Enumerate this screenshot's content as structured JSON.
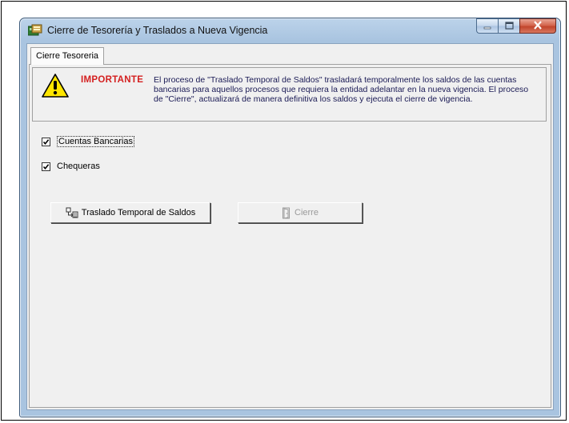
{
  "window": {
    "title": "Cierre de Tesorería  y Traslados a Nueva Vigencia"
  },
  "tabs": [
    {
      "label": "Cierre Tesoreria"
    }
  ],
  "notice": {
    "label": "IMPORTANTE",
    "text": "El proceso de \"Traslado Temporal de Saldos\" trasladará temporalmente los saldos de las cuentas bancarias para aquellos procesos que requiera la entidad adelantar en la nueva vigencia. El proceso de \"Cierre\", actualizará de manera definitiva los saldos y ejecuta el cierre de vigencia.",
    "label_color": "#d42020",
    "text_color": "#1a1a55"
  },
  "options": [
    {
      "label": "Cuentas Bancarias",
      "checked": true
    },
    {
      "label": "Chequeras",
      "checked": true
    }
  ],
  "buttons": {
    "traslado": {
      "label": "Traslado Temporal de Saldos",
      "icon": "transfer-icon",
      "enabled": true
    },
    "cierre": {
      "label": "Cierre",
      "icon": "door-icon",
      "enabled": false
    }
  },
  "caption_buttons": [
    "minimize-icon",
    "maximize-icon",
    "close-icon"
  ]
}
